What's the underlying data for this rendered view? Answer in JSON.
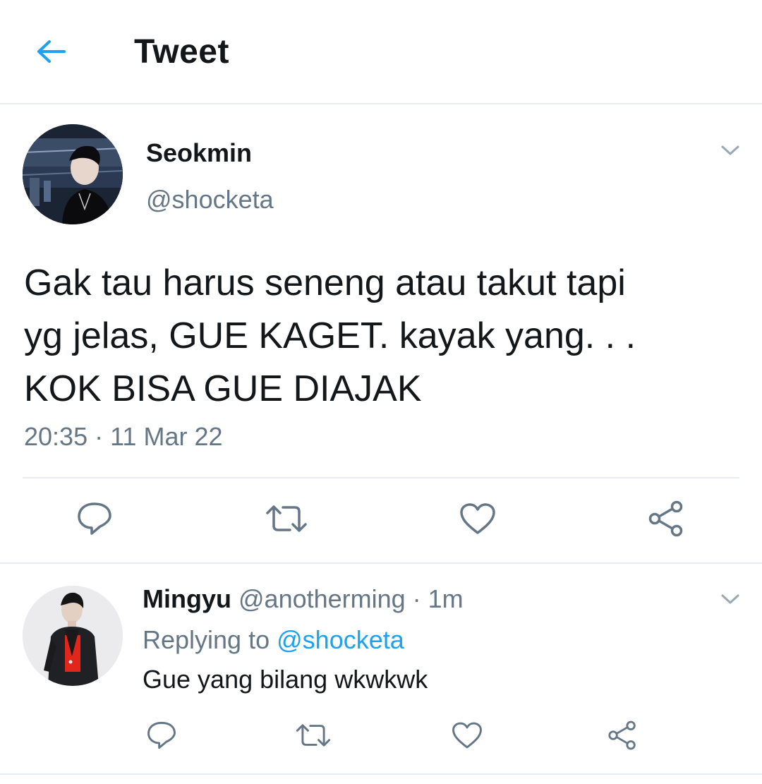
{
  "header": {
    "back_icon": "arrow-left-icon",
    "title": "Tweet",
    "accent_color": "#1da1f2"
  },
  "main_tweet": {
    "display_name": "Seokmin",
    "handle": "@shocketa",
    "text_lines": [
      "Gak tau harus seneng atau takut tapi",
      "yg jelas, GUE KAGET. kayak yang. . .",
      "KOK BISA GUE DIAJAK"
    ],
    "timestamp": "20:35 · 11 Mar 22",
    "menu_icon": "chevron-down-icon",
    "actions": [
      "reply-icon",
      "retweet-icon",
      "like-icon",
      "share-icon"
    ]
  },
  "reply": {
    "display_name": "Mingyu",
    "meta": "@anotherming · 1m",
    "replying_prefix": "Replying to",
    "replying_to": "@shocketa",
    "text": "Gue yang bilang wkwkwk",
    "menu_icon": "chevron-down-icon",
    "actions": [
      "reply-icon",
      "retweet-icon",
      "like-icon",
      "share-icon"
    ]
  },
  "colors": {
    "text_primary": "#14171a",
    "text_secondary": "#657786",
    "link": "#1da1f2",
    "divider": "#e6ecf0"
  }
}
